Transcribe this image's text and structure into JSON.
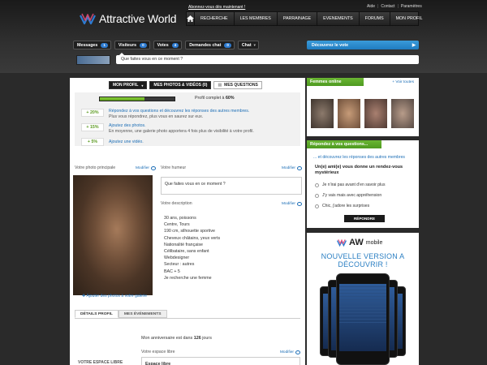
{
  "brand": {
    "name": "Attractive World",
    "signup_text": "Abonnez-vous dès maintenant !"
  },
  "top_links": [
    "Aide",
    "Contact",
    "Paramètres"
  ],
  "main_nav": [
    "RECHERCHE",
    "LES MEMBRES",
    "PARRAINAGE",
    "EVENEMENTS",
    "FORUMS",
    "MON PROFIL"
  ],
  "counters": [
    {
      "label": "Messages",
      "count": "1"
    },
    {
      "label": "Visiteurs",
      "count": "0"
    },
    {
      "label": "Votes",
      "count": "4"
    },
    {
      "label": "Demandes chat",
      "count": "0"
    },
    {
      "label": "Chat",
      "count": ""
    }
  ],
  "discover": {
    "label": "Découvrez le vote"
  },
  "status": {
    "text": "Que faites vous en ce moment ?"
  },
  "profile_tabs": [
    "MON PROFIL",
    "MES PHOTOS & VIDÉOS (0)",
    "MES QUESTIONS"
  ],
  "completion": {
    "percent": 60,
    "label_prefix": "Profil complet à ",
    "label_value": "60%",
    "tips": [
      {
        "points": "+ 20%",
        "title": "Répondez à vos questions et découvrez les réponses des autres membres.",
        "sub": "Plus vous répondrez, plus vous en saurez sur eux."
      },
      {
        "points": "+ 15%",
        "title": "Ajoutez des photos.",
        "sub": "En moyenne, une galerie photo apportera 4 fois plus de visibilité à votre profil."
      },
      {
        "points": "+ 5%",
        "title": "Ajoutez une vidéo.",
        "sub": ""
      }
    ]
  },
  "main_photo": {
    "heading": "Votre photo principale",
    "modify": "Modifier",
    "add_link": "Ajouter des photos à votre galerie"
  },
  "mood": {
    "heading": "Votre humeur",
    "modify": "Modifier",
    "text": "Que faites vous en ce moment ?"
  },
  "description": {
    "heading": "Votre description",
    "modify": "Modifier",
    "lines": [
      "30 ans, poissons",
      "Centre, Tours",
      "190 cm, silhouette sportive",
      "Cheveux châtains, yeux verts",
      "Nationalité française",
      "Célibataire, sans enfant",
      "Webdesigner",
      "Secteur : autres",
      "BAC + 5",
      "Je recherche une femme"
    ]
  },
  "details_tabs": [
    "DÉTAILS PROFIL",
    "MES ÉVÉNEMENTS"
  ],
  "birthday": {
    "prefix": "Mon anniversaire est dans ",
    "days": "126",
    "suffix": " jours"
  },
  "free_space": {
    "left_label": "VOTRE ESPACE LIBRE",
    "heading": "Votre espace libre",
    "modify": "Modifier",
    "content": "Espace libre"
  },
  "online": {
    "heading": "Femmes online",
    "see_all": "Voir toutes"
  },
  "question": {
    "heading": "Répondez à vos questions...",
    "sub": "... et découvrez les réponses des autres membres",
    "text": "Un(e) ami(e) vous donne un rendez-vous mystérieux",
    "options": [
      "Je n'irai pas avant d'en savoir plus",
      "J'y vais mais avec appréhension",
      "Chic, j'adore les surprises"
    ],
    "button": "RÉPONDRE"
  },
  "ad": {
    "brand": "AW",
    "brand_sub": "mobile",
    "line1": "NOUVELLE VERSION A",
    "line2": "DÉCOUVRIR !"
  },
  "colors": {
    "accent_blue": "#2e7bd0",
    "accent_green": "#5ea11a",
    "link": "#1c6eb6"
  }
}
